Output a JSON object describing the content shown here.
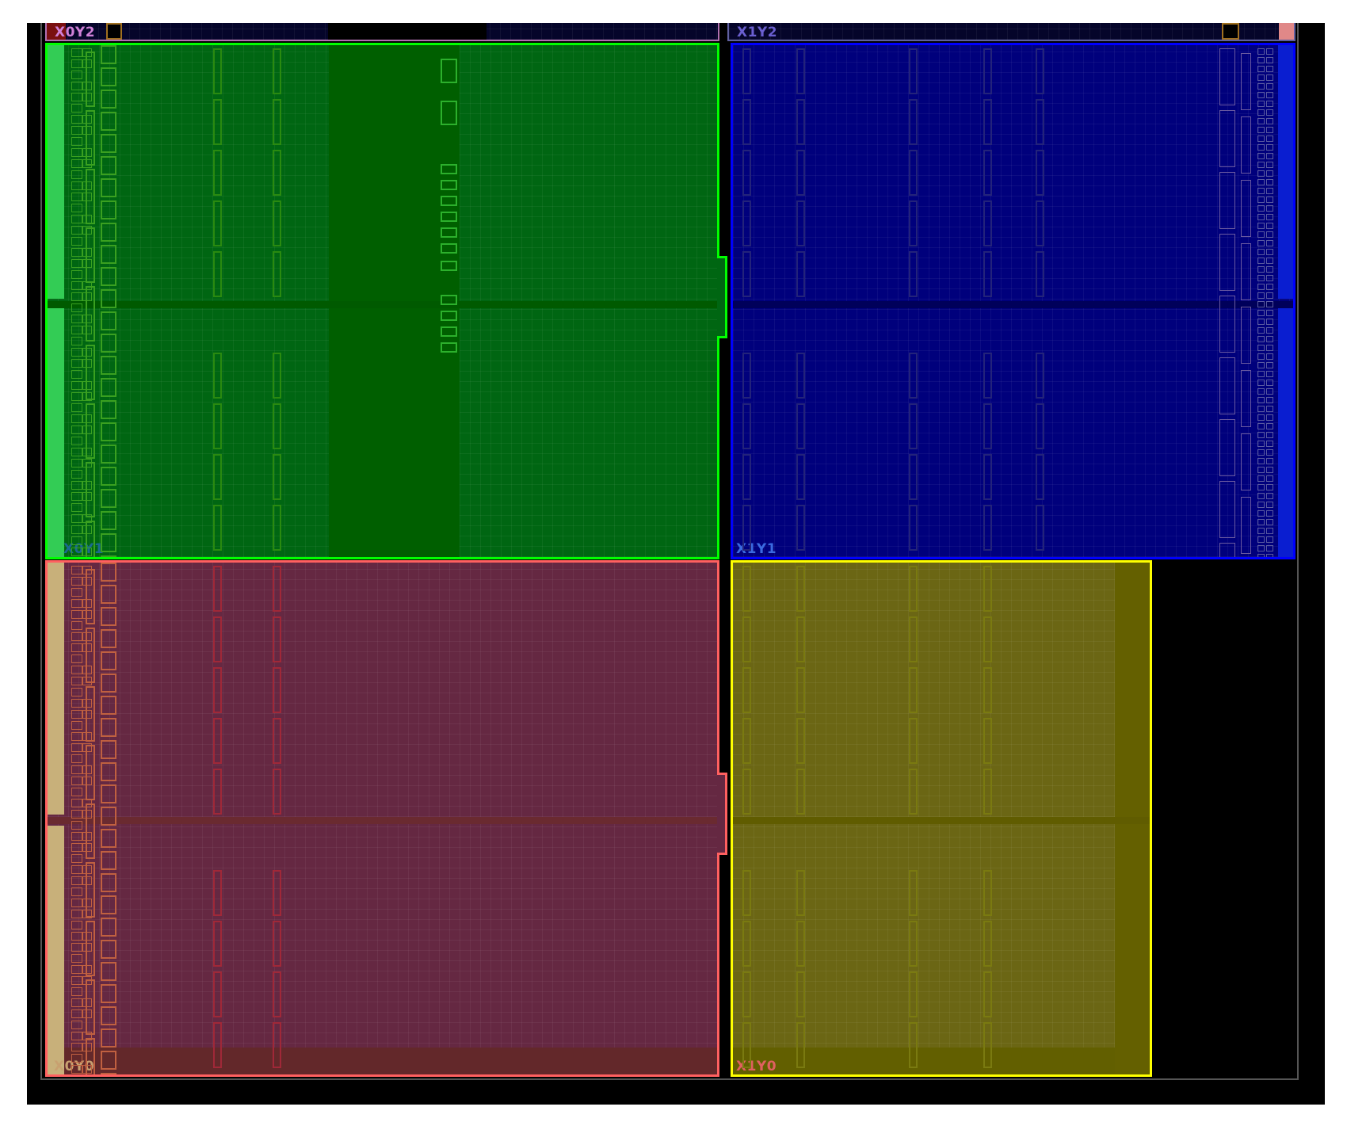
{
  "view": "Device floorplan",
  "clock_regions": [
    {
      "id": "X0Y2",
      "label": "X0Y2",
      "fill": "#0a0a3a",
      "border": "#b070b0",
      "label_color": "#d080d8"
    },
    {
      "id": "X1Y2",
      "label": "X1Y2",
      "fill": "#0a0a3a",
      "border": "#6060a0",
      "label_color": "#6a5fd0"
    },
    {
      "id": "X0Y1",
      "label": "X0Y1",
      "fill": "#006612",
      "border": "#00ff00",
      "label_color": "#1a6a90"
    },
    {
      "id": "X1Y1",
      "label": "X1Y1",
      "fill": "#00007c",
      "border": "#0000ff",
      "label_color": "#3a6ae0"
    },
    {
      "id": "X0Y0",
      "label": "X0Y0",
      "fill": "#652842",
      "border": "#ff6060",
      "label_color": "#c8a070"
    },
    {
      "id": "X1Y0",
      "label": "X1Y0",
      "fill": "#6b6614",
      "border": "#ffff00",
      "label_color": "#e06060"
    }
  ]
}
